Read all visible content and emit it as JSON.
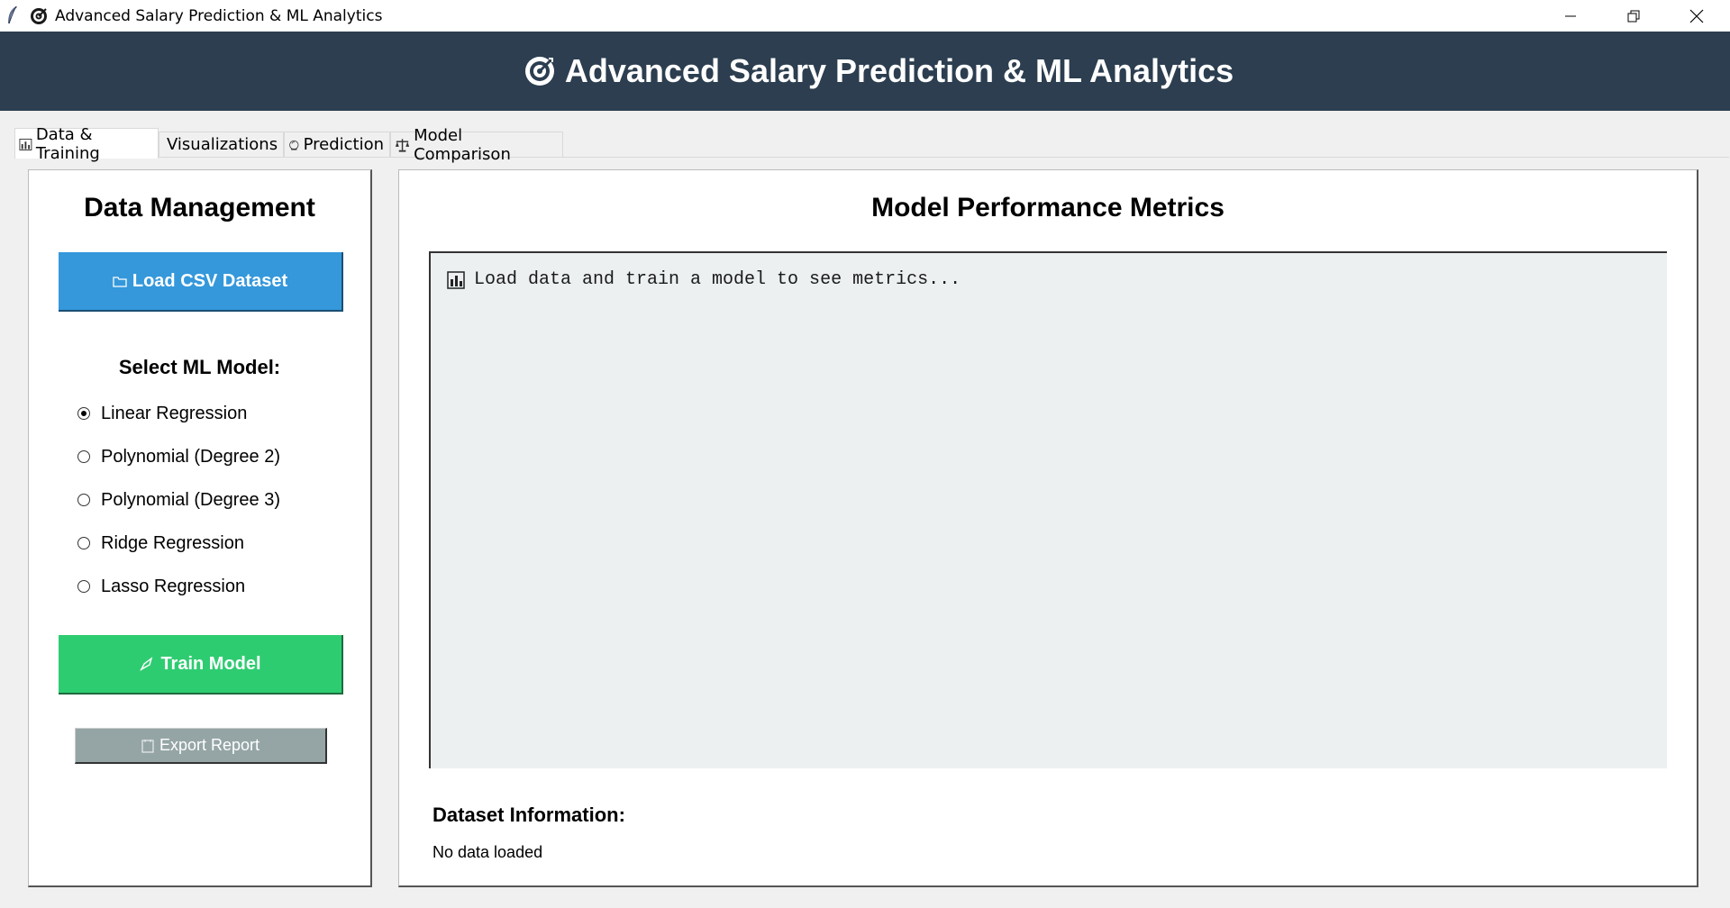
{
  "window": {
    "title": "Advanced Salary Prediction & ML Analytics",
    "controls": [
      "minimize",
      "restore",
      "close"
    ]
  },
  "header": {
    "icon": "target-icon",
    "title": "Advanced Salary Prediction & ML Analytics",
    "background": "#2c3e50"
  },
  "tabs": [
    {
      "label": "Data & Training",
      "icon": "bar-chart-icon",
      "active": true
    },
    {
      "label": "Visualizations",
      "icon": "chart-check-icon",
      "active": false
    },
    {
      "label": "Prediction",
      "icon": "crystal-ball-icon",
      "active": false
    },
    {
      "label": "Model Comparison",
      "icon": "scales-icon",
      "active": false
    }
  ],
  "data_management": {
    "title": "Data Management",
    "load_button": "Load CSV Dataset",
    "select_label": "Select ML Model:",
    "models": [
      {
        "label": "Linear Regression",
        "selected": true
      },
      {
        "label": "Polynomial (Degree 2)",
        "selected": false
      },
      {
        "label": "Polynomial (Degree 3)",
        "selected": false
      },
      {
        "label": "Ridge Regression",
        "selected": false
      },
      {
        "label": "Lasso Regression",
        "selected": false
      }
    ],
    "train_button": "Train Model",
    "export_button": "Export Report"
  },
  "metrics": {
    "title": "Model Performance Metrics",
    "placeholder": "Load data and train a model to see metrics...",
    "dataset_label": "Dataset Information:",
    "dataset_value": "No data loaded"
  },
  "colors": {
    "load_button": "#3498db",
    "train_button": "#2ecc71",
    "export_button": "#95a5a6",
    "metrics_bg": "#ecf0f1"
  }
}
